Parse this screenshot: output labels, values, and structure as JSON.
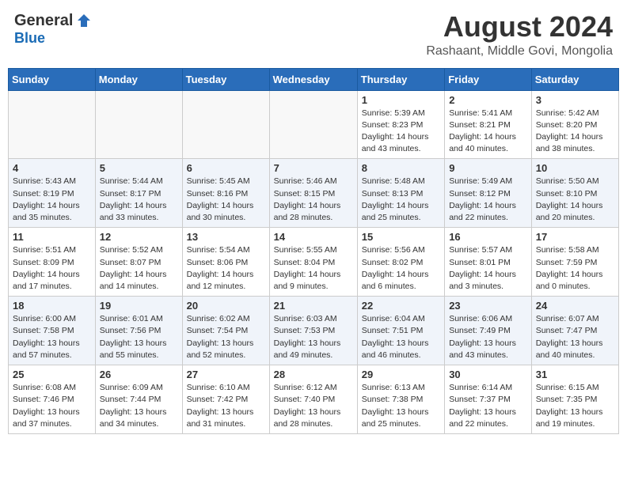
{
  "header": {
    "logo_general": "General",
    "logo_blue": "Blue",
    "month_title": "August 2024",
    "location": "Rashaant, Middle Govi, Mongolia"
  },
  "days_of_week": [
    "Sunday",
    "Monday",
    "Tuesday",
    "Wednesday",
    "Thursday",
    "Friday",
    "Saturday"
  ],
  "weeks": [
    [
      {
        "day": "",
        "info": ""
      },
      {
        "day": "",
        "info": ""
      },
      {
        "day": "",
        "info": ""
      },
      {
        "day": "",
        "info": ""
      },
      {
        "day": "1",
        "info": "Sunrise: 5:39 AM\nSunset: 8:23 PM\nDaylight: 14 hours\nand 43 minutes."
      },
      {
        "day": "2",
        "info": "Sunrise: 5:41 AM\nSunset: 8:21 PM\nDaylight: 14 hours\nand 40 minutes."
      },
      {
        "day": "3",
        "info": "Sunrise: 5:42 AM\nSunset: 8:20 PM\nDaylight: 14 hours\nand 38 minutes."
      }
    ],
    [
      {
        "day": "4",
        "info": "Sunrise: 5:43 AM\nSunset: 8:19 PM\nDaylight: 14 hours\nand 35 minutes."
      },
      {
        "day": "5",
        "info": "Sunrise: 5:44 AM\nSunset: 8:17 PM\nDaylight: 14 hours\nand 33 minutes."
      },
      {
        "day": "6",
        "info": "Sunrise: 5:45 AM\nSunset: 8:16 PM\nDaylight: 14 hours\nand 30 minutes."
      },
      {
        "day": "7",
        "info": "Sunrise: 5:46 AM\nSunset: 8:15 PM\nDaylight: 14 hours\nand 28 minutes."
      },
      {
        "day": "8",
        "info": "Sunrise: 5:48 AM\nSunset: 8:13 PM\nDaylight: 14 hours\nand 25 minutes."
      },
      {
        "day": "9",
        "info": "Sunrise: 5:49 AM\nSunset: 8:12 PM\nDaylight: 14 hours\nand 22 minutes."
      },
      {
        "day": "10",
        "info": "Sunrise: 5:50 AM\nSunset: 8:10 PM\nDaylight: 14 hours\nand 20 minutes."
      }
    ],
    [
      {
        "day": "11",
        "info": "Sunrise: 5:51 AM\nSunset: 8:09 PM\nDaylight: 14 hours\nand 17 minutes."
      },
      {
        "day": "12",
        "info": "Sunrise: 5:52 AM\nSunset: 8:07 PM\nDaylight: 14 hours\nand 14 minutes."
      },
      {
        "day": "13",
        "info": "Sunrise: 5:54 AM\nSunset: 8:06 PM\nDaylight: 14 hours\nand 12 minutes."
      },
      {
        "day": "14",
        "info": "Sunrise: 5:55 AM\nSunset: 8:04 PM\nDaylight: 14 hours\nand 9 minutes."
      },
      {
        "day": "15",
        "info": "Sunrise: 5:56 AM\nSunset: 8:02 PM\nDaylight: 14 hours\nand 6 minutes."
      },
      {
        "day": "16",
        "info": "Sunrise: 5:57 AM\nSunset: 8:01 PM\nDaylight: 14 hours\nand 3 minutes."
      },
      {
        "day": "17",
        "info": "Sunrise: 5:58 AM\nSunset: 7:59 PM\nDaylight: 14 hours\nand 0 minutes."
      }
    ],
    [
      {
        "day": "18",
        "info": "Sunrise: 6:00 AM\nSunset: 7:58 PM\nDaylight: 13 hours\nand 57 minutes."
      },
      {
        "day": "19",
        "info": "Sunrise: 6:01 AM\nSunset: 7:56 PM\nDaylight: 13 hours\nand 55 minutes."
      },
      {
        "day": "20",
        "info": "Sunrise: 6:02 AM\nSunset: 7:54 PM\nDaylight: 13 hours\nand 52 minutes."
      },
      {
        "day": "21",
        "info": "Sunrise: 6:03 AM\nSunset: 7:53 PM\nDaylight: 13 hours\nand 49 minutes."
      },
      {
        "day": "22",
        "info": "Sunrise: 6:04 AM\nSunset: 7:51 PM\nDaylight: 13 hours\nand 46 minutes."
      },
      {
        "day": "23",
        "info": "Sunrise: 6:06 AM\nSunset: 7:49 PM\nDaylight: 13 hours\nand 43 minutes."
      },
      {
        "day": "24",
        "info": "Sunrise: 6:07 AM\nSunset: 7:47 PM\nDaylight: 13 hours\nand 40 minutes."
      }
    ],
    [
      {
        "day": "25",
        "info": "Sunrise: 6:08 AM\nSunset: 7:46 PM\nDaylight: 13 hours\nand 37 minutes."
      },
      {
        "day": "26",
        "info": "Sunrise: 6:09 AM\nSunset: 7:44 PM\nDaylight: 13 hours\nand 34 minutes."
      },
      {
        "day": "27",
        "info": "Sunrise: 6:10 AM\nSunset: 7:42 PM\nDaylight: 13 hours\nand 31 minutes."
      },
      {
        "day": "28",
        "info": "Sunrise: 6:12 AM\nSunset: 7:40 PM\nDaylight: 13 hours\nand 28 minutes."
      },
      {
        "day": "29",
        "info": "Sunrise: 6:13 AM\nSunset: 7:38 PM\nDaylight: 13 hours\nand 25 minutes."
      },
      {
        "day": "30",
        "info": "Sunrise: 6:14 AM\nSunset: 7:37 PM\nDaylight: 13 hours\nand 22 minutes."
      },
      {
        "day": "31",
        "info": "Sunrise: 6:15 AM\nSunset: 7:35 PM\nDaylight: 13 hours\nand 19 minutes."
      }
    ]
  ]
}
